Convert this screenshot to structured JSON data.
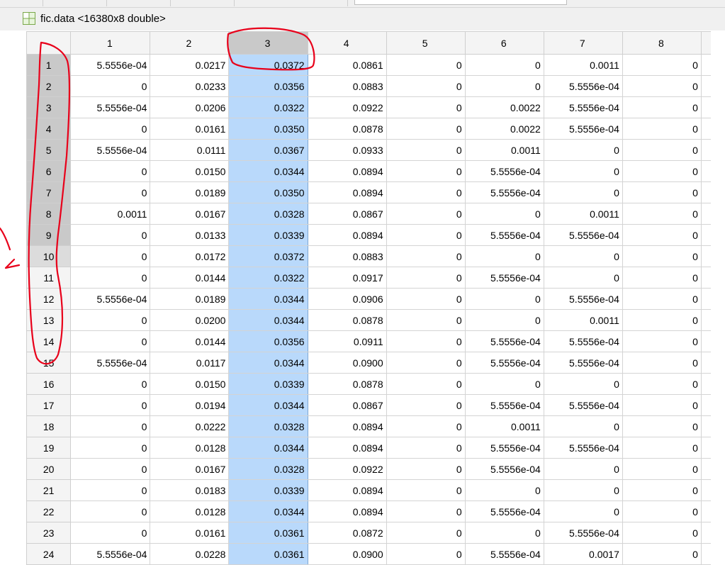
{
  "variable_title": "fic.data <16380x8 double>",
  "columns": [
    "1",
    "2",
    "3",
    "4",
    "5",
    "6",
    "7",
    "8"
  ],
  "selected_column": "3",
  "selection_color": "#b9d9fb",
  "annotation_color": "#e8001a",
  "rows": [
    {
      "n": "1",
      "v": [
        "5.5556e-04",
        "0.0217",
        "0.0372",
        "0.0861",
        "0",
        "0",
        "0.0011",
        "0"
      ]
    },
    {
      "n": "2",
      "v": [
        "0",
        "0.0233",
        "0.0356",
        "0.0883",
        "0",
        "0",
        "5.5556e-04",
        "0"
      ]
    },
    {
      "n": "3",
      "v": [
        "5.5556e-04",
        "0.0206",
        "0.0322",
        "0.0922",
        "0",
        "0.0022",
        "5.5556e-04",
        "0"
      ]
    },
    {
      "n": "4",
      "v": [
        "0",
        "0.0161",
        "0.0350",
        "0.0878",
        "0",
        "0.0022",
        "5.5556e-04",
        "0"
      ]
    },
    {
      "n": "5",
      "v": [
        "5.5556e-04",
        "0.0111",
        "0.0367",
        "0.0933",
        "0",
        "0.0011",
        "0",
        "0"
      ]
    },
    {
      "n": "6",
      "v": [
        "0",
        "0.0150",
        "0.0344",
        "0.0894",
        "0",
        "5.5556e-04",
        "0",
        "0"
      ]
    },
    {
      "n": "7",
      "v": [
        "0",
        "0.0189",
        "0.0350",
        "0.0894",
        "0",
        "5.5556e-04",
        "0",
        "0"
      ]
    },
    {
      "n": "8",
      "v": [
        "0.0011",
        "0.0167",
        "0.0328",
        "0.0867",
        "0",
        "0",
        "0.0011",
        "0"
      ]
    },
    {
      "n": "9",
      "v": [
        "0",
        "0.0133",
        "0.0339",
        "0.0894",
        "0",
        "5.5556e-04",
        "5.5556e-04",
        "0"
      ]
    },
    {
      "n": "10",
      "v": [
        "0",
        "0.0172",
        "0.0372",
        "0.0883",
        "0",
        "0",
        "0",
        "0"
      ]
    },
    {
      "n": "11",
      "v": [
        "0",
        "0.0144",
        "0.0322",
        "0.0917",
        "0",
        "5.5556e-04",
        "0",
        "0"
      ]
    },
    {
      "n": "12",
      "v": [
        "5.5556e-04",
        "0.0189",
        "0.0344",
        "0.0906",
        "0",
        "0",
        "5.5556e-04",
        "0"
      ]
    },
    {
      "n": "13",
      "v": [
        "0",
        "0.0200",
        "0.0344",
        "0.0878",
        "0",
        "0",
        "0.0011",
        "0"
      ]
    },
    {
      "n": "14",
      "v": [
        "0",
        "0.0144",
        "0.0356",
        "0.0911",
        "0",
        "5.5556e-04",
        "5.5556e-04",
        "0"
      ]
    },
    {
      "n": "15",
      "v": [
        "5.5556e-04",
        "0.0117",
        "0.0344",
        "0.0900",
        "0",
        "5.5556e-04",
        "5.5556e-04",
        "0"
      ]
    },
    {
      "n": "16",
      "v": [
        "0",
        "0.0150",
        "0.0339",
        "0.0878",
        "0",
        "0",
        "0",
        "0"
      ]
    },
    {
      "n": "17",
      "v": [
        "0",
        "0.0194",
        "0.0344",
        "0.0867",
        "0",
        "5.5556e-04",
        "5.5556e-04",
        "0"
      ]
    },
    {
      "n": "18",
      "v": [
        "0",
        "0.0222",
        "0.0328",
        "0.0894",
        "0",
        "0.0011",
        "0",
        "0"
      ]
    },
    {
      "n": "19",
      "v": [
        "0",
        "0.0128",
        "0.0344",
        "0.0894",
        "0",
        "5.5556e-04",
        "5.5556e-04",
        "0"
      ]
    },
    {
      "n": "20",
      "v": [
        "0",
        "0.0167",
        "0.0328",
        "0.0922",
        "0",
        "5.5556e-04",
        "0",
        "0"
      ]
    },
    {
      "n": "21",
      "v": [
        "0",
        "0.0183",
        "0.0339",
        "0.0894",
        "0",
        "0",
        "0",
        "0"
      ]
    },
    {
      "n": "22",
      "v": [
        "0",
        "0.0128",
        "0.0344",
        "0.0894",
        "0",
        "5.5556e-04",
        "0",
        "0"
      ]
    },
    {
      "n": "23",
      "v": [
        "0",
        "0.0161",
        "0.0361",
        "0.0872",
        "0",
        "0",
        "5.5556e-04",
        "0"
      ]
    },
    {
      "n": "24",
      "v": [
        "5.5556e-04",
        "0.0228",
        "0.0361",
        "0.0900",
        "0",
        "5.5556e-04",
        "0.0017",
        "0"
      ]
    }
  ]
}
